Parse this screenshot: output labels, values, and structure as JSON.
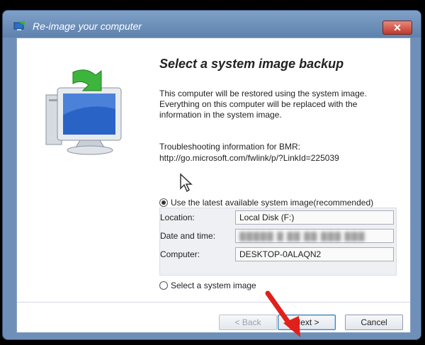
{
  "window": {
    "title": "Re-image your computer",
    "close_label": "✕"
  },
  "page": {
    "heading": "Select a system image backup",
    "description": "This computer will be restored using the system image. Everything on this computer will be replaced with the information in the system image.",
    "bmr_line1": "Troubleshooting information for BMR:",
    "bmr_line2": "http://go.microsoft.com/fwlink/p/?LinkId=225039"
  },
  "options": {
    "latest_label": "Use the latest available system image(recommended)",
    "select_label": "Select a system image",
    "selected": "latest"
  },
  "fields": {
    "location_label": "Location:",
    "location_value": "Local Disk (F:)",
    "datetime_label": "Date and time:",
    "datetime_value": "",
    "computer_label": "Computer:",
    "computer_value": "DESKTOP-0ALAQN2"
  },
  "buttons": {
    "back": "< Back",
    "next": "Next >",
    "cancel": "Cancel"
  },
  "colors": {
    "annotation_arrow": "#e0201a"
  }
}
